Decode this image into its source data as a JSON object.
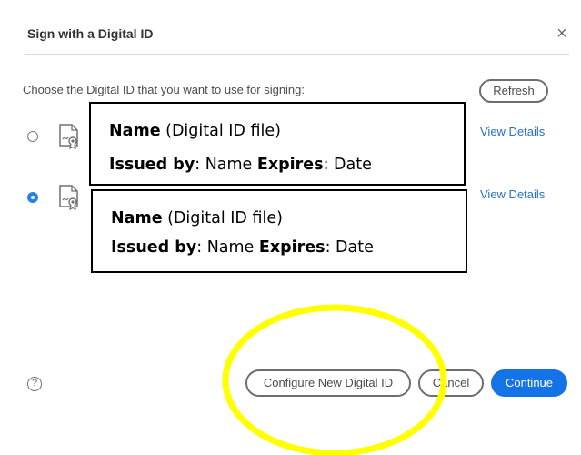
{
  "dialog": {
    "title": "Sign with a Digital ID",
    "close_glyph": "×",
    "prompt": "Choose the Digital ID that you want to use for signing:",
    "refresh_label": "Refresh"
  },
  "ids": [
    {
      "selected": false,
      "name": "Name",
      "name_suffix": " (Digital ID file)",
      "issued_by_label": "Issued by",
      "issued_by_value": ": Name ",
      "expires_label": "Expires",
      "expires_value": ": Date",
      "view_details": "View Details",
      "icon": "certificate-icon"
    },
    {
      "selected": true,
      "name": "Name",
      "name_suffix": " (Digital ID file)",
      "issued_by_label": "Issued by",
      "issued_by_value": ": Name ",
      "expires_label": "Expires",
      "expires_value": ": Date",
      "view_details": "View Details",
      "icon": "certificate-icon"
    }
  ],
  "footer": {
    "help_glyph": "?",
    "configure_label": "Configure New Digital ID",
    "cancel_label": "Cancel",
    "continue_label": "Continue"
  },
  "colors": {
    "accent": "#1473e6",
    "link": "#2a70c8",
    "highlight": "#ffff00"
  }
}
